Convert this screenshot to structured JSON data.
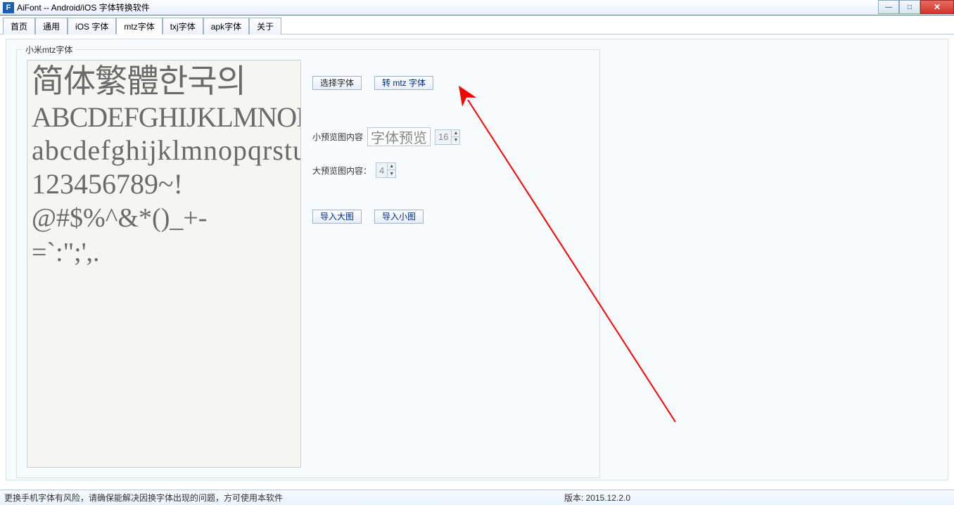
{
  "window": {
    "icon_letter": "F",
    "title": "AiFont -- Android/iOS 字体转换软件"
  },
  "tabs": [
    {
      "label": "首页"
    },
    {
      "label": "通用"
    },
    {
      "label": "iOS 字体"
    },
    {
      "label": "mtz字体",
      "active": true
    },
    {
      "label": "txj字体"
    },
    {
      "label": "apk字体"
    },
    {
      "label": "关于"
    }
  ],
  "group": {
    "title": "小米mtz字体"
  },
  "preview_text": {
    "cjk": "简体繁體한국의",
    "upper": "ABCDEFGHIJKLMNOPQRSTUVWXYZ",
    "lower": "abcdefghijklmnopqrstuvwxyz",
    "digits": "123456789~!",
    "sym1": "@#$%^&*()_+-",
    "sym2": "=`:\";',."
  },
  "controls": {
    "select_font": "选择字体",
    "convert_mtz": "转 mtz 字体",
    "small_label": "小预览图内容",
    "small_value": "字体预览",
    "small_size": "16",
    "large_label": "大预览图内容：",
    "large_size": "4",
    "import_large": "导入大图",
    "import_small": "导入小图"
  },
  "status": {
    "msg": "更换手机字体有风险，请确保能解决因换字体出现的问题，方可使用本软件",
    "version": "版本: 2015.12.2.0"
  }
}
